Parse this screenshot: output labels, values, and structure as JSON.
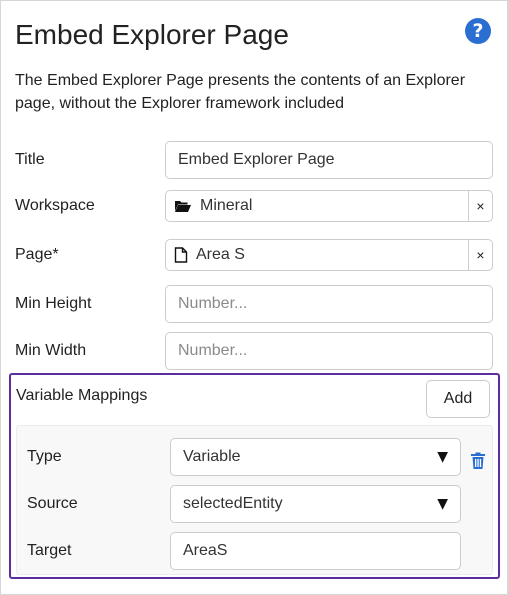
{
  "header": {
    "title": "Embed Explorer Page",
    "help_icon": "question-circle-icon"
  },
  "description": "The Embed Explorer Page presents the contents of an Explorer page, without the Explorer framework included",
  "form": {
    "title": {
      "label": "Title",
      "value": "Embed Explorer Page"
    },
    "workspace": {
      "label": "Workspace",
      "value": "Mineral",
      "icon": "folder-open-icon",
      "clear": "×"
    },
    "page": {
      "label": "Page*",
      "value": "Area S",
      "icon": "file-icon",
      "clear": "×"
    },
    "min_height": {
      "label": "Min Height",
      "placeholder": "Number..."
    },
    "min_width": {
      "label": "Min Width",
      "placeholder": "Number..."
    }
  },
  "variable_mappings": {
    "label": "Variable Mappings",
    "add_label": "Add",
    "mapping": {
      "type": {
        "label": "Type",
        "value": "Variable",
        "caret": "▼"
      },
      "source": {
        "label": "Source",
        "value": "selectedEntity",
        "caret": "▼"
      },
      "target": {
        "label": "Target",
        "value": "AreaS"
      },
      "delete_icon": "trash-icon"
    }
  },
  "colors": {
    "accent": "#2b6ed1",
    "highlight_border": "#5b2d9e"
  }
}
